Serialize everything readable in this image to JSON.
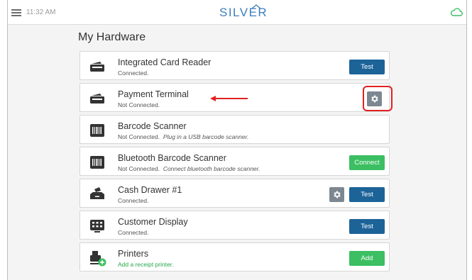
{
  "topbar": {
    "time": "11:32 AM",
    "brand": "SILVER",
    "menu_icon": "hamburger-menu-icon",
    "cloud_icon": "cloud-icon",
    "brand_color": "#3d7dbd"
  },
  "page": {
    "title": "My Hardware"
  },
  "devices": [
    {
      "name": "Integrated Card Reader",
      "status": "Connected.",
      "icon": "card-reader-icon",
      "button": "Test"
    },
    {
      "name": "Payment Terminal",
      "status": "Not Connected.",
      "icon": "card-reader-icon",
      "settings_icon": "gear-icon"
    },
    {
      "name": "Barcode Scanner",
      "status": "Not Connected.",
      "hint": "Plug in a USB barcode scanner.",
      "icon": "barcode-icon"
    },
    {
      "name": "Bluetooth Barcode Scanner",
      "status": "Not Connected.",
      "hint": "Connect bluetooth barcode scanner.",
      "icon": "barcode-icon",
      "button": "Connect"
    },
    {
      "name": "Cash Drawer #1",
      "status": "Connected.",
      "icon": "cash-drawer-icon",
      "settings_icon": "gear-icon",
      "button": "Test"
    },
    {
      "name": "Customer Display",
      "status": "Connected.",
      "icon": "display-icon",
      "button": "Test"
    },
    {
      "name": "Printers",
      "status": "Add a receipt printer.",
      "icon": "printer-add-icon",
      "button": "Add"
    }
  ],
  "colors": {
    "primary_button": "#1c6398",
    "success_button": "#3bbf62",
    "gear_button": "#7d8791",
    "annotation_red": "#e32121"
  }
}
